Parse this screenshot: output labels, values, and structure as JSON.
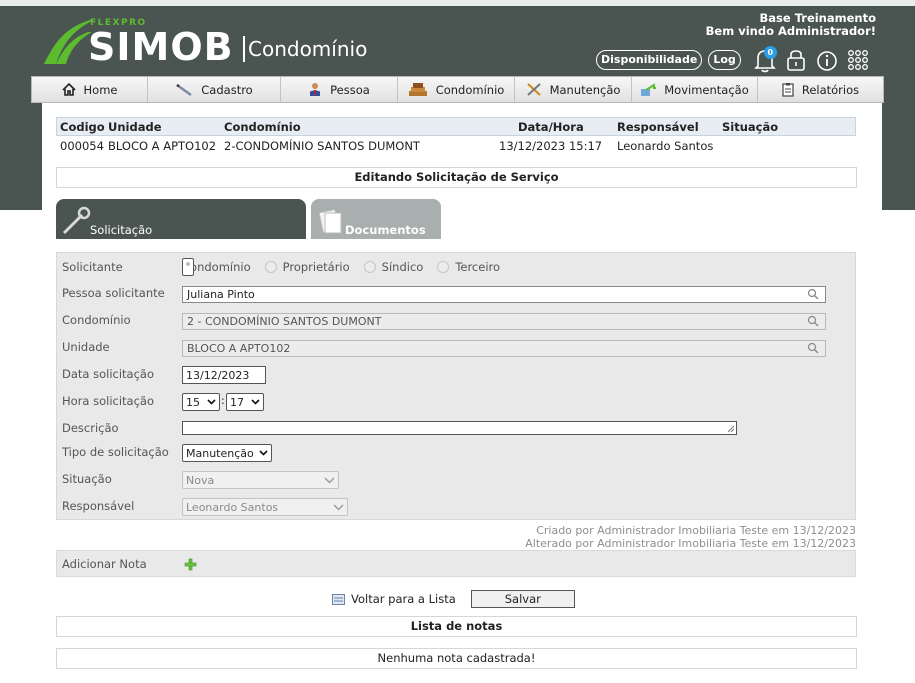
{
  "header": {
    "logo_small": "FLEXPRO",
    "logo_main": "SIMOB",
    "logo_sub": "Condomínio",
    "company": "Base Treinamento",
    "welcome": "Bem vindo Administrador!",
    "disponibilidade_label": "Disponibilidade",
    "log_label": "Log",
    "notification_count": "0"
  },
  "menu": {
    "items": [
      {
        "label": "Home",
        "icon": "home-icon"
      },
      {
        "label": "Cadastro",
        "icon": "pencil-icon"
      },
      {
        "label": "Pessoa",
        "icon": "person-icon"
      },
      {
        "label": "Condomínio",
        "icon": "building-icon"
      },
      {
        "label": "Manutenção",
        "icon": "tools-icon"
      },
      {
        "label": "Movimentação",
        "icon": "exchange-icon"
      },
      {
        "label": "Relatórios",
        "icon": "clipboard-icon"
      }
    ]
  },
  "record": {
    "headers": {
      "codigo": "Codigo",
      "unidade": "Unidade",
      "condominio": "Condomínio",
      "data_hora": "Data/Hora",
      "responsavel": "Responsável",
      "situacao": "Situação"
    },
    "row": {
      "codigo": "000054",
      "unidade": "BLOCO A APTO102",
      "condominio": "2-CONDOMÍNIO SANTOS DUMONT",
      "data_hora": "13/12/2023 15:17",
      "responsavel": "Leonardo Santos",
      "situacao": ""
    }
  },
  "editing_title": "Editando Solicitação de Serviço",
  "tabs": {
    "solicitacao": "Solicitação",
    "documentos": "Documentos"
  },
  "form": {
    "labels": {
      "solicitante": "Solicitante",
      "pessoa": "Pessoa solicitante",
      "condominio": "Condomínio",
      "unidade": "Unidade",
      "data": "Data solicitação",
      "hora": "Hora solicitação",
      "descricao": "Descrição",
      "tipo": "Tipo de solicitação",
      "situacao": "Situação",
      "responsavel": "Responsável"
    },
    "solicitante_options": [
      "Condomínio",
      "Proprietário",
      "Síndico",
      "Terceiro"
    ],
    "solicitante_selected": "Condomínio",
    "pessoa_value": "Juliana Pinto",
    "condominio_value": "2 - CONDOMÍNIO SANTOS DUMONT",
    "unidade_value": "BLOCO A APTO102",
    "data_value": "13/12/2023",
    "hora_value": "15",
    "minuto_value": "17",
    "hora_sep": ":",
    "descricao_value": "",
    "tipo_value": "Manutenção",
    "situacao_value": "Nova",
    "responsavel_value": "Leonardo Santos"
  },
  "audit": {
    "created": "Criado por Administrador Imobiliaria Teste em 13/12/2023",
    "altered": "Alterado por Administrador Imobiliaria Teste em 13/12/2023"
  },
  "notes": {
    "add_label": "Adicionar Nota",
    "list_title": "Lista de notas",
    "empty": "Nenhuma nota cadastrada!"
  },
  "actions": {
    "back": "Voltar para a Lista",
    "save": "Salvar"
  },
  "colors": {
    "header_bg": "#4a5552",
    "brand_green": "#5dbb2e",
    "badge_blue": "#2a9ee8",
    "tab_inactive": "#a9aeae",
    "form_bg": "#e9e9e9"
  }
}
